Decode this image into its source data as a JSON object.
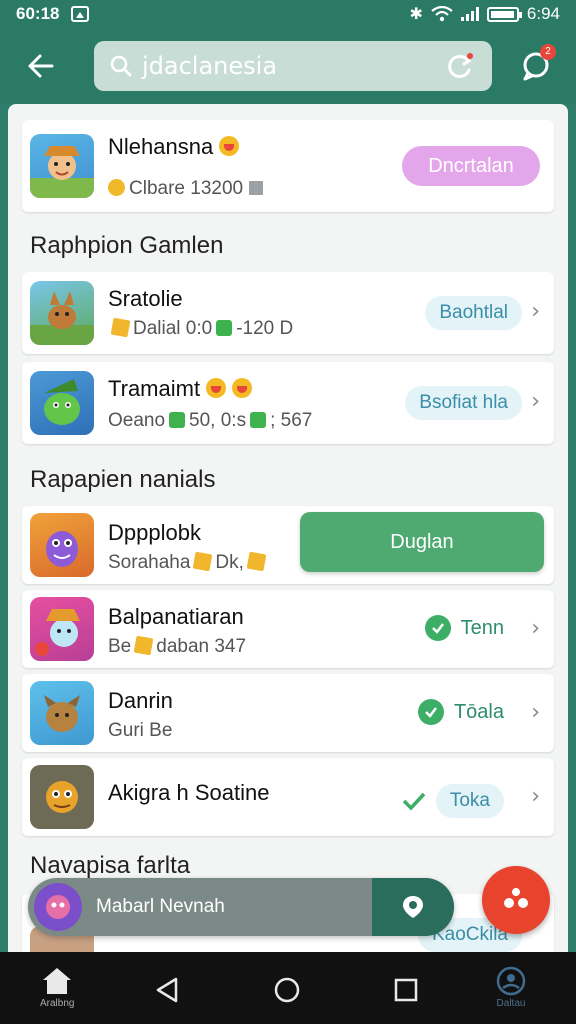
{
  "status_bar": {
    "time": "60:18",
    "battery": "6:94"
  },
  "search": {
    "query": "jdaclanesia"
  },
  "notifications": {
    "badge": "2"
  },
  "featured": {
    "title": "Nlehansna",
    "subtitle": "Clbare 13200",
    "button_label": "Dncrtalan"
  },
  "section1": {
    "title": "Raphpion Gamlen",
    "items": [
      {
        "title": "Sratolie",
        "subtitle": "Dalial 0:0",
        "subtitle_extra": "-120 D",
        "action": "Baohtlal"
      },
      {
        "title": "Tramaimt",
        "subtitle": "Oeano",
        "subtitle_mid": "50, 0:s",
        "subtitle_extra": "; 567",
        "action": "Bsofiat hla"
      }
    ]
  },
  "section2": {
    "title": "Rapapien nanials",
    "items": [
      {
        "title": "Dppplobk",
        "subtitle": "Sorahaha",
        "subtitle_extra": "Dk,",
        "action": "Duglan",
        "action_type": "button"
      },
      {
        "title": "Balpanatiaran",
        "subtitle": "Be",
        "subtitle_extra": "daban 347",
        "action": "Tenn",
        "action_type": "check"
      },
      {
        "title": "Danrin",
        "subtitle": "Guri Be",
        "action": "Tōala",
        "action_type": "check"
      },
      {
        "title": "Akigra h Soatine",
        "subtitle": "",
        "action": "Toka",
        "action_type": "tick"
      }
    ]
  },
  "section3": {
    "title": "Navapisa farlta",
    "peek_action": "KaoCkila"
  },
  "mini_player": {
    "label": "Mabarl Nevnah"
  },
  "nav": {
    "home_label": "Aralbng",
    "profile_label": "Daltau"
  }
}
